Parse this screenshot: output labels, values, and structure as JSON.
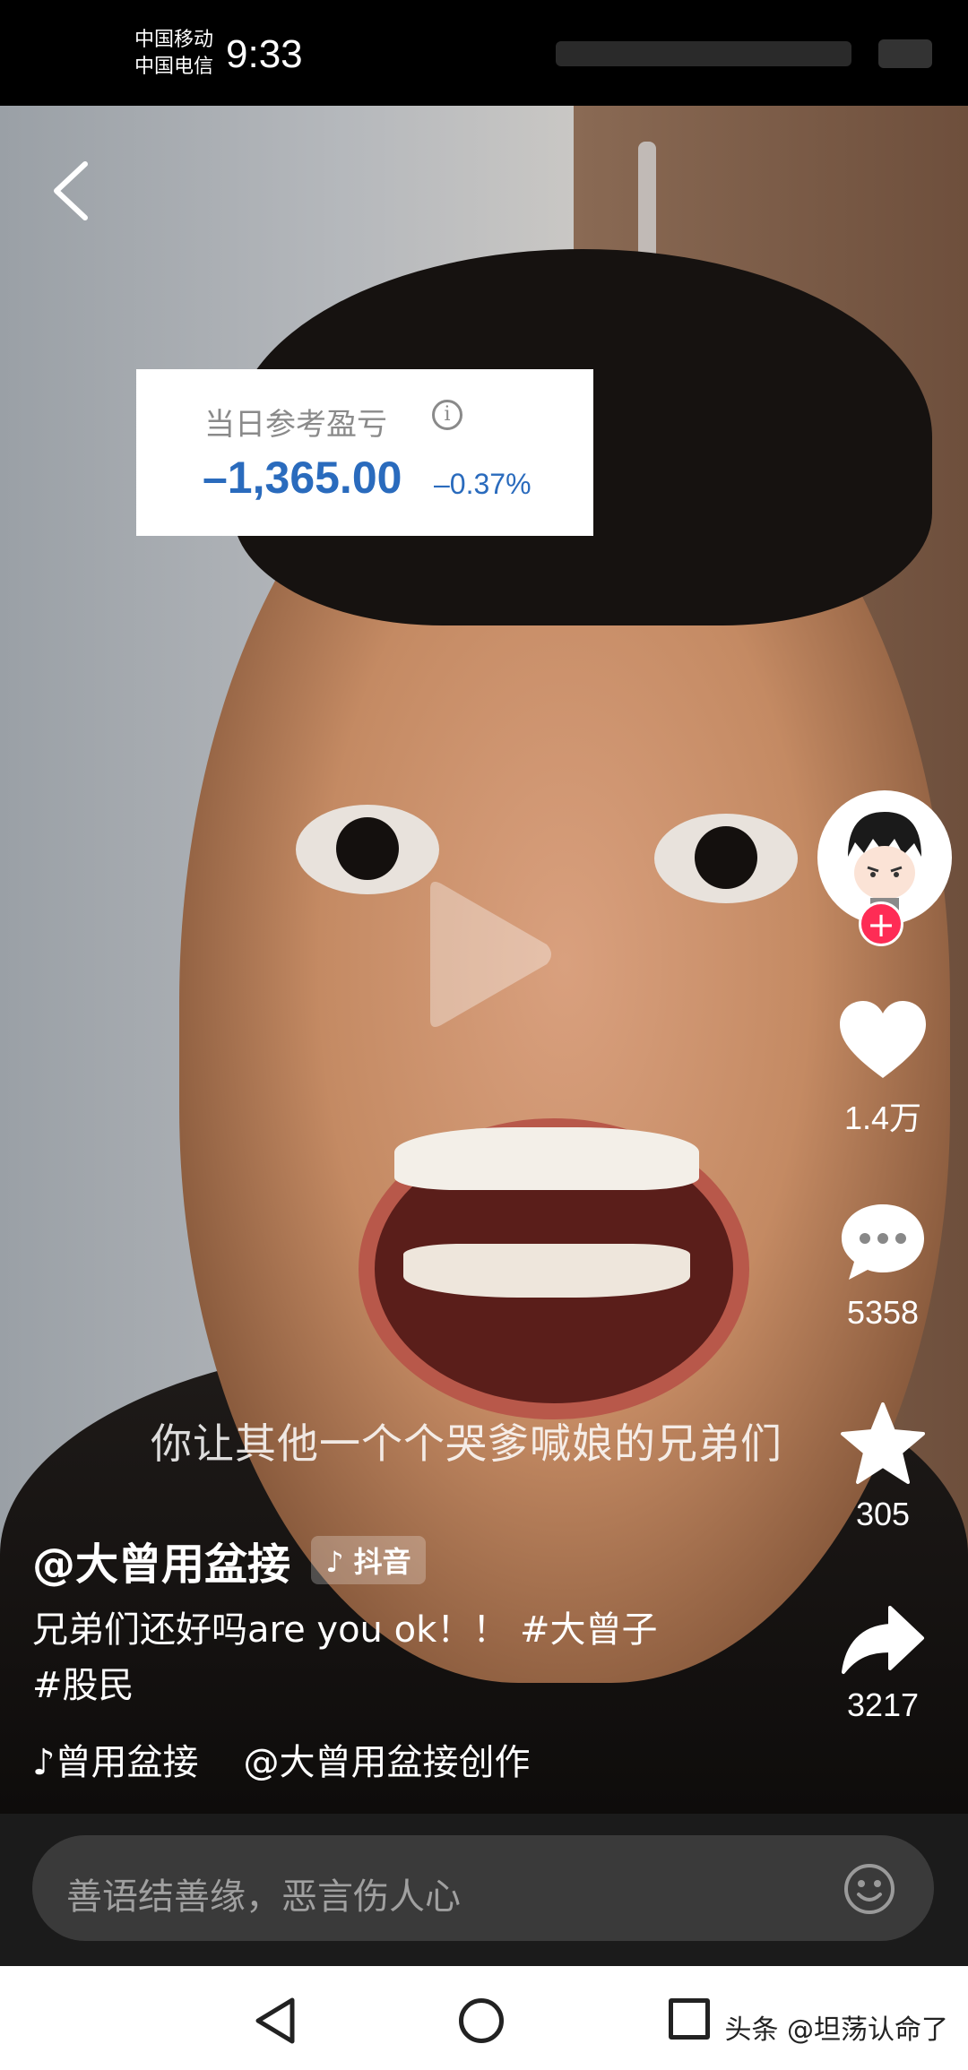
{
  "status_bar": {
    "carrier_1": "中国移动",
    "carrier_2": "中国电信",
    "time": "9:33"
  },
  "pnl_card": {
    "title": "当日参考盈亏",
    "value": "–1,365.00",
    "percent": "–0.37%",
    "accent_color": "#2a6bbd"
  },
  "video": {
    "subtitle": "你让其他一个个哭爹喊娘的兄弟们"
  },
  "actions": {
    "like_count": "1.4万",
    "comment_count": "5358",
    "favorite_count": "305",
    "share_count": "3217",
    "follow_color": "#fe2c55"
  },
  "post": {
    "author": "@大曾用盆接",
    "platform_badge": "抖音",
    "caption": "兄弟们还好吗are you ok！！ #大曾子 #股民",
    "music_owner": "曾用盆接",
    "music_title": "@大曾用盆接创作"
  },
  "comment_bar": {
    "placeholder": "善语结善缘，恶言伤人心"
  },
  "watermark": "头条 @坦荡认命了"
}
